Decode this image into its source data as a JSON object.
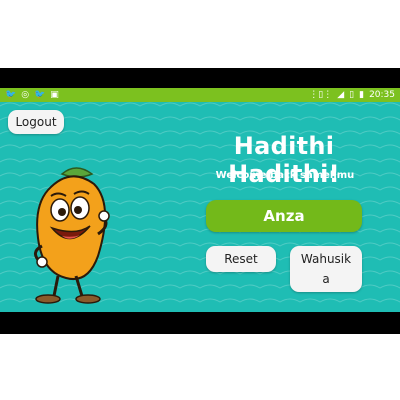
{
  "status_bar": {
    "time": "20:35",
    "left_icons": [
      "twitter-icon",
      "whatsapp-icon",
      "twitter-icon",
      "image-icon"
    ],
    "right_icons": [
      "vibrate-icon",
      "signal-icon",
      "no-sim-icon",
      "battery-icon"
    ]
  },
  "header": {
    "logout_label": "Logout"
  },
  "main": {
    "title": "Hadithi Hadithi!",
    "subtitle": "Welcome back samelimu",
    "start_label": "Anza",
    "reset_label": "Reset",
    "characters_label": "Wahusika"
  },
  "colors": {
    "background": "#1fbdb4",
    "status_bar": "#7cc11f",
    "primary_button": "#73b91a",
    "secondary_button": "#f4f4f4"
  },
  "mascot": {
    "icon": "mango-character-icon"
  }
}
